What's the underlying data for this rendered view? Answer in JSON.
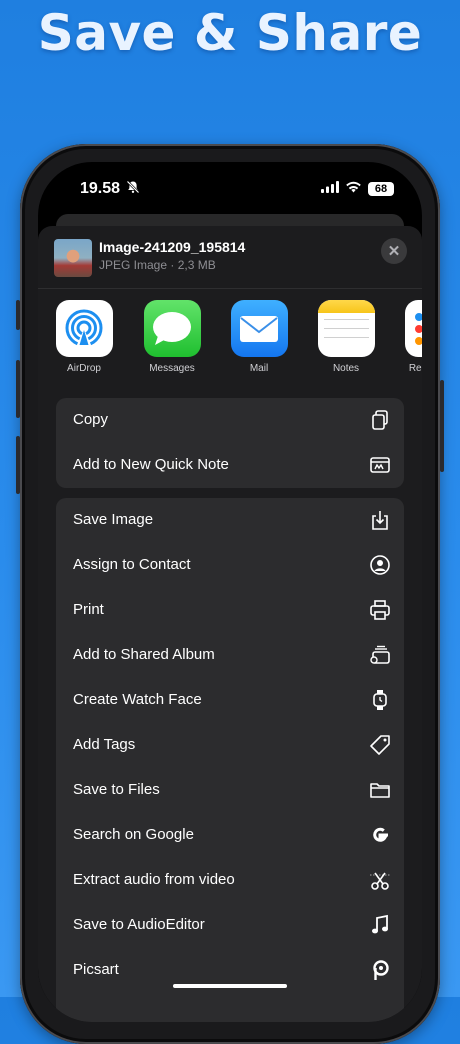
{
  "banner": {
    "title": "Save & Share"
  },
  "status_bar": {
    "time": "19.58",
    "battery": "68"
  },
  "file": {
    "name": "Image-241209_195814",
    "meta": "JPEG Image · 2,3 MB"
  },
  "apps": [
    {
      "label": "AirDrop",
      "icon": "airdrop-icon"
    },
    {
      "label": "Messages",
      "icon": "messages-icon"
    },
    {
      "label": "Mail",
      "icon": "mail-icon"
    },
    {
      "label": "Notes",
      "icon": "notes-icon"
    },
    {
      "label": "Reminders",
      "icon": "reminders-icon"
    }
  ],
  "actions_group1": [
    {
      "label": "Copy",
      "icon": "copy-icon"
    },
    {
      "label": "Add to New Quick Note",
      "icon": "quick-note-icon"
    }
  ],
  "actions_group2": [
    {
      "label": "Save Image",
      "icon": "save-image-icon"
    },
    {
      "label": "Assign to Contact",
      "icon": "contact-icon"
    },
    {
      "label": "Print",
      "icon": "printer-icon"
    },
    {
      "label": "Add to Shared Album",
      "icon": "shared-album-icon"
    },
    {
      "label": "Create Watch Face",
      "icon": "watch-icon"
    },
    {
      "label": "Add Tags",
      "icon": "tag-icon"
    },
    {
      "label": "Save to Files",
      "icon": "folder-icon"
    },
    {
      "label": "Search on Google",
      "icon": "google-icon"
    },
    {
      "label": "Extract audio from video",
      "icon": "scissors-icon"
    },
    {
      "label": "Save to AudioEditor",
      "icon": "music-note-icon"
    },
    {
      "label": "Picsart",
      "icon": "picsart-icon"
    }
  ]
}
